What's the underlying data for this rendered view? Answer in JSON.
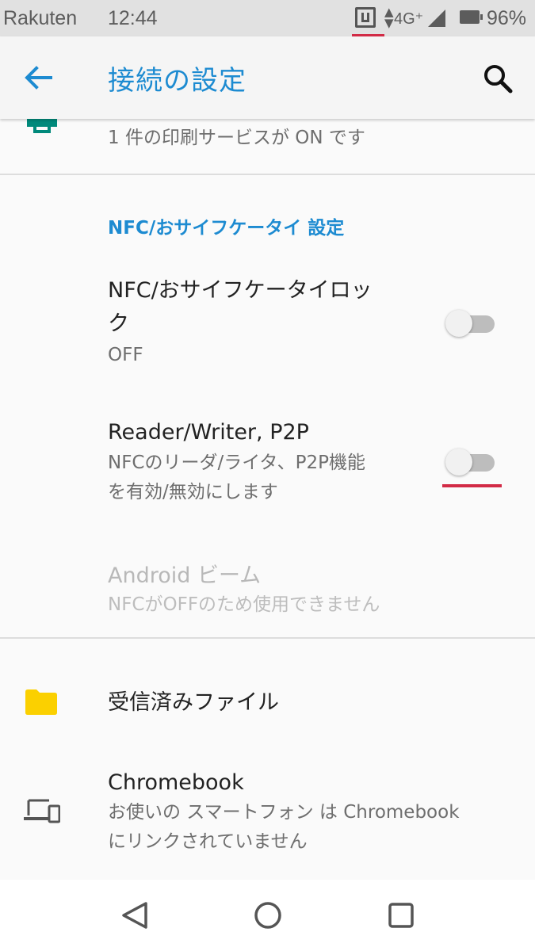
{
  "status_bar": {
    "carrier": "Rakuten",
    "time": "12:44",
    "network": "4G⁺",
    "battery": "96%",
    "icons": [
      "nfc-icon",
      "data-arrows-icon",
      "signal-icon",
      "battery-icon"
    ]
  },
  "app_bar": {
    "title": "接続の設定",
    "back_icon": "back-arrow-icon",
    "search_icon": "search-icon"
  },
  "printing": {
    "subtitle": "1 件の印刷サービスが ON です",
    "icon": "print-icon"
  },
  "nfc_section": {
    "header": "NFC/おサイフケータイ 設定",
    "lock": {
      "title_line1": "NFC/おサイフケータイロッ",
      "title_line2": "ク",
      "status": "OFF",
      "enabled": false
    },
    "reader_writer": {
      "title": "Reader/Writer, P2P",
      "desc_line1": "NFCのリーダ/ライタ、P2P機能",
      "desc_line2": "を有効/無効にします",
      "enabled": false
    },
    "android_beam": {
      "title": "Android ビーム",
      "desc": "NFCがOFFのため使用できません"
    }
  },
  "received_files": {
    "title": "受信済みファイル",
    "icon": "folder-icon"
  },
  "chromebook": {
    "title": "Chromebook",
    "desc_line1": "お使いの スマートフォン は Chromebook",
    "desc_line2": "にリンクされていません",
    "icon": "devices-icon"
  },
  "colors": {
    "accent": "#1d8bd1",
    "highlight": "#d22b46",
    "folder": "#fbd000",
    "print": "#00897b"
  },
  "nav_bar": {
    "icons": [
      "back-triangle-icon",
      "home-circle-icon",
      "recents-square-icon"
    ]
  }
}
